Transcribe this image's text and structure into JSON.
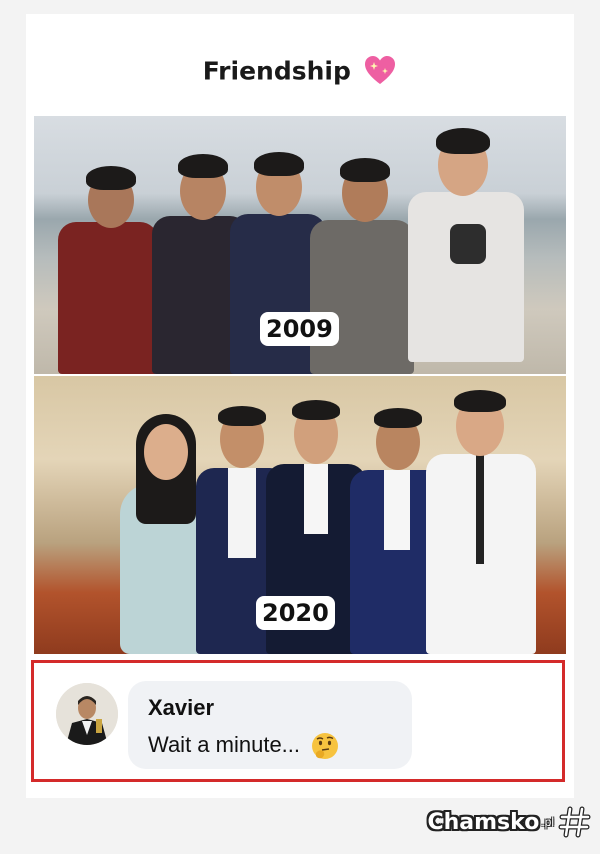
{
  "post": {
    "title": "Friendship",
    "title_emoji": "sparkling-heart-icon"
  },
  "photos": [
    {
      "year_label": "2009"
    },
    {
      "year_label": "2020"
    }
  ],
  "comment": {
    "author": "Xavier",
    "text": "Wait a minute...",
    "emoji": "thinking-face-icon"
  },
  "watermark": {
    "text": "Chamsko",
    "suffix": ".pl"
  },
  "colors": {
    "comment_border": "#d42a2a",
    "bubble_bg": "#f0f2f5"
  }
}
